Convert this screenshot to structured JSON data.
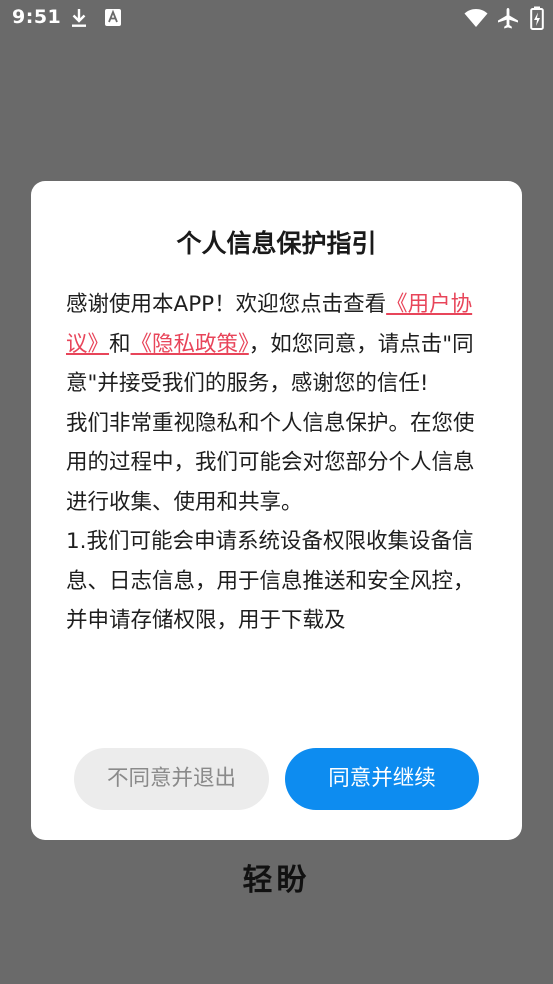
{
  "status_bar": {
    "time": "9:51",
    "icons": [
      "download-icon",
      "a-icon",
      "wifi-icon",
      "airplane-icon",
      "battery-charging-icon"
    ]
  },
  "background": {
    "tagline": "",
    "app_name": "轻盼"
  },
  "dialog": {
    "title": "个人信息保护指引",
    "body": {
      "intro_prefix": "感谢使用本APP！欢迎您点击查看",
      "user_agreement_link": "《用户协议》",
      "and_text": "和",
      "privacy_policy_link": "《隐私政策》",
      "intro_suffix": "，如您同意，请点击\"同意\"并接受我们的服务，感谢您的信任!",
      "paragraph2": "我们非常重视隐私和个人信息保护。在您使用的过程中，我们可能会对您部分个人信息进行收集、使用和共享。",
      "paragraph3": "1.我们可能会申请系统设备权限收集设备信息、日志信息，用于信息推送和安全风控，并申请存储权限，用于下载及"
    },
    "buttons": {
      "disagree_label": "不同意并退出",
      "agree_label": "同意并继续"
    }
  },
  "colors": {
    "link": "#e8455a",
    "primary_button": "#0d8cf0",
    "secondary_button": "#ececec",
    "overlay": "#6a6a6a"
  }
}
